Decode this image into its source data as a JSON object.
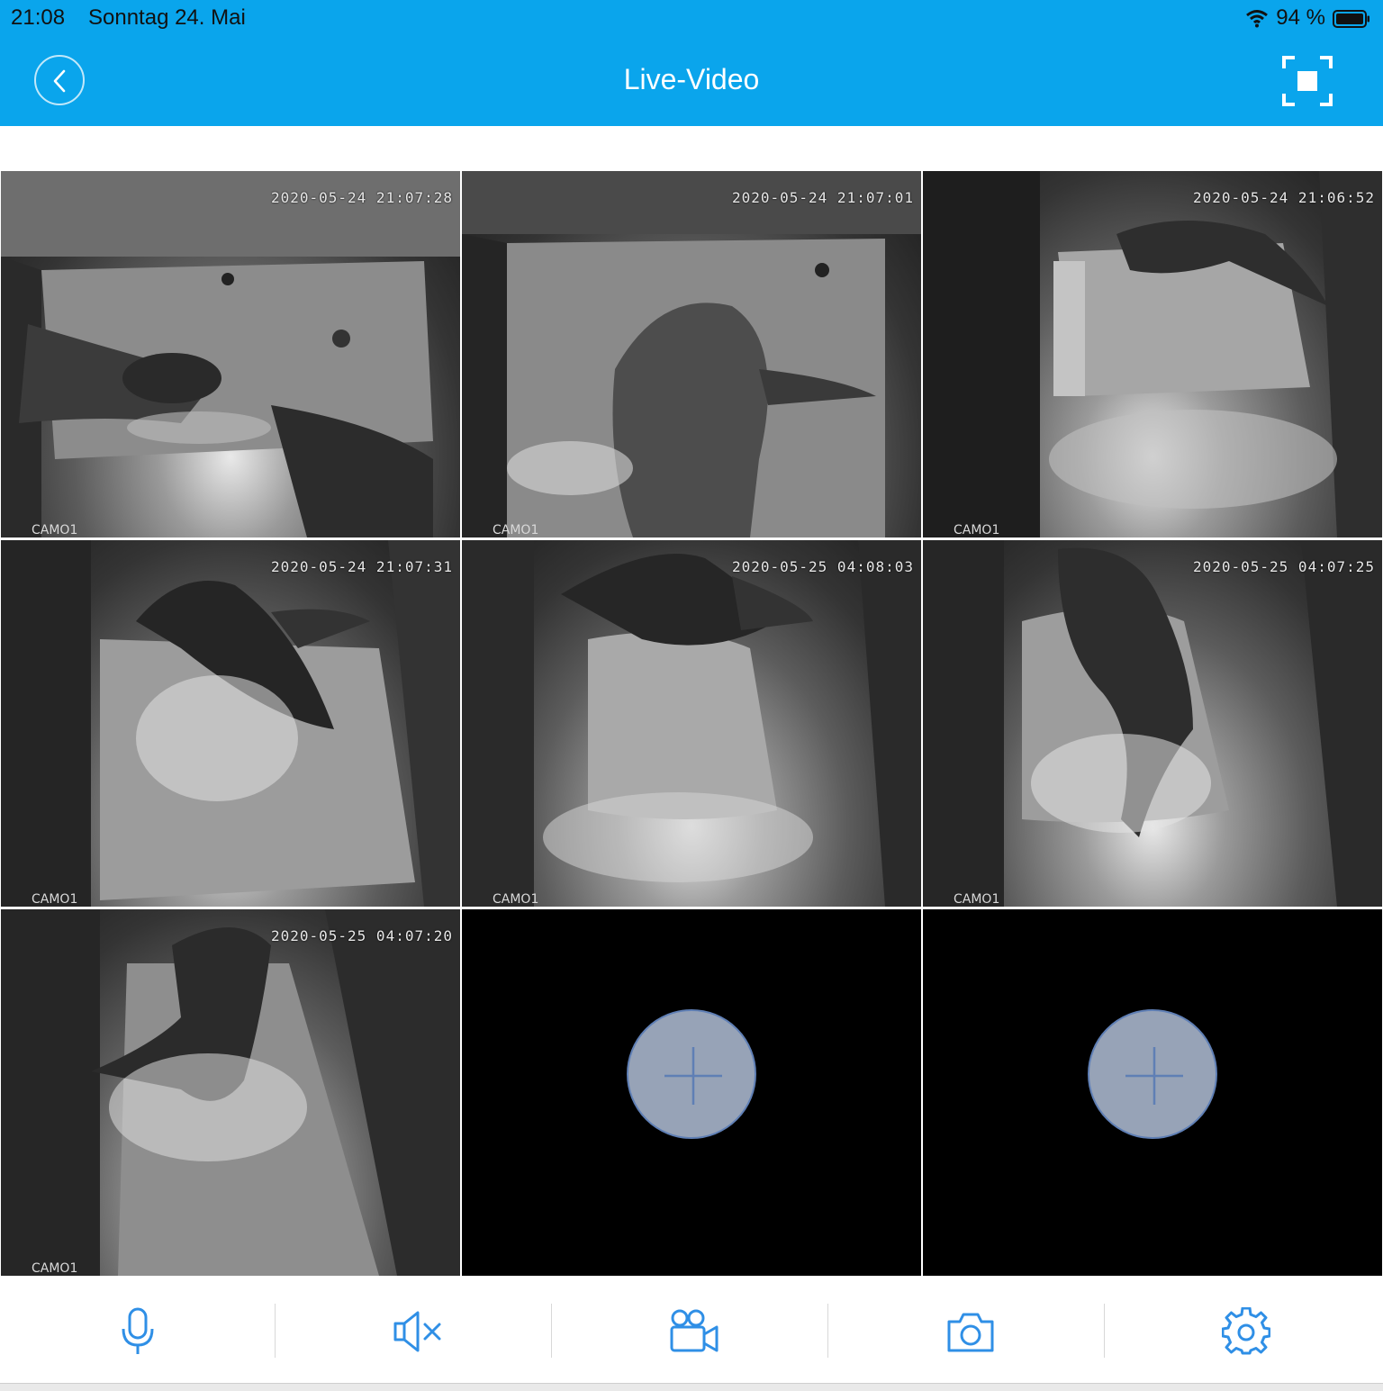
{
  "status_bar": {
    "time": "21:08",
    "date": "Sonntag 24. Mai",
    "battery": "94 %",
    "icons": [
      "wifi-icon",
      "battery-icon"
    ]
  },
  "header": {
    "title": "Live-Video",
    "back_icon": "chevron-left-icon",
    "fullscreen_icon": "fullscreen-icon"
  },
  "colors": {
    "header": "#0aa5ec",
    "accent": "#2f8fe6",
    "add_button_fill": "#97a3b7"
  },
  "tiles": [
    {
      "timestamp": "2020-05-24 21:07:28",
      "camera": "CAMO1"
    },
    {
      "timestamp": "2020-05-24 21:07:01",
      "camera": "CAMO1"
    },
    {
      "timestamp": "2020-05-24 21:06:52",
      "camera": "CAMO1"
    },
    {
      "timestamp": "2020-05-24 21:07:31",
      "camera": "CAMO1"
    },
    {
      "timestamp": "2020-05-25 04:08:03",
      "camera": "CAMO1"
    },
    {
      "timestamp": "2020-05-25 04:07:25",
      "camera": "CAMO1"
    },
    {
      "timestamp": "2020-05-25 04:07:20",
      "camera": "CAMO1"
    }
  ],
  "empty_slots": [
    {
      "icon": "plus-icon"
    },
    {
      "icon": "plus-icon"
    }
  ],
  "toolbar": [
    {
      "icon": "microphone-icon"
    },
    {
      "icon": "speaker-mute-icon"
    },
    {
      "icon": "video-camera-icon"
    },
    {
      "icon": "camera-icon"
    },
    {
      "icon": "gear-icon"
    }
  ]
}
